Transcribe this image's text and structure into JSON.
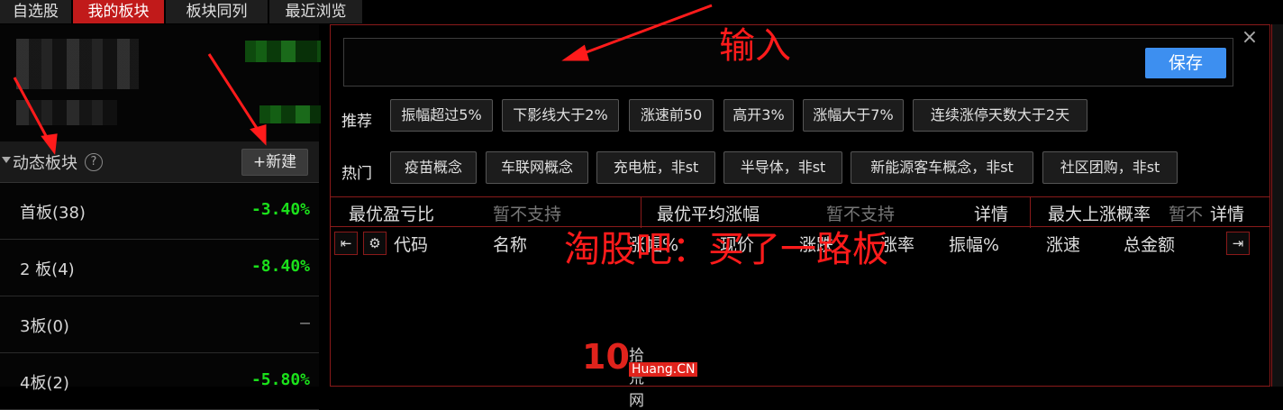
{
  "tabs": [
    "自选股",
    "我的板块",
    "板块同列",
    "最近浏览"
  ],
  "active_tab": 1,
  "left": {
    "group_title": "动态板块",
    "help_label": "?",
    "new_button": "+新建",
    "rows": [
      {
        "name": "首板(38)",
        "value": "-3.40%",
        "color": "#1be01b"
      },
      {
        "name": "2 板(4)",
        "value": "-8.40%",
        "color": "#1be01b"
      },
      {
        "name": "3板(0)",
        "value": "—",
        "color": "#9a9a9a"
      },
      {
        "name": "4板(2)",
        "value": "-5.80%",
        "color": "#1be01b"
      }
    ]
  },
  "editor": {
    "input_value": "",
    "save_button": "保存",
    "close_icon": "×",
    "recommend_label": "推荐",
    "recommend": [
      "振幅超过5%",
      "下影线大于2%",
      "涨速前50",
      "高开3%",
      "涨幅大于7%",
      "连续涨停天数大于2天"
    ],
    "hot_label": "热门",
    "hot": [
      "疫苗概念",
      "车联网概念",
      "充电桩，非st",
      "半导体，非st",
      "新能源客车概念，非st",
      "社区团购，非st"
    ]
  },
  "stats": [
    {
      "label": "最优盈亏比",
      "value": "暂不支持"
    },
    {
      "label": "最优平均涨幅",
      "value": "暂不支持",
      "detail": "详情"
    },
    {
      "label": "最大上涨概率",
      "value": "暂不",
      "detail": "详情"
    }
  ],
  "columns": [
    "代码",
    "名称",
    "涨幅%",
    "现价",
    "涨跌",
    "涨率",
    "振幅%",
    "涨速",
    "总金额"
  ],
  "overlay_text": "淘股吧：买了一路板",
  "annotation_input": "输入",
  "watermark": {
    "num": "10",
    "cn": "拾荒网",
    "en": "Huang.CN"
  },
  "colors": {
    "active_tab": "#c11a1a",
    "save": "#3d8ff0",
    "down": "#1be01b",
    "annotation": "#ff1b1b"
  }
}
